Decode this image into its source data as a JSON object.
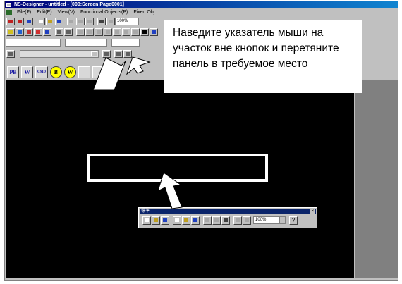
{
  "window": {
    "title": "NS-Designer - untitled - [000:Screen Page0001]"
  },
  "menubar": {
    "items": [
      "File(F)",
      "Edit(E)",
      "View(V)",
      "Functional Objects(P)",
      "Fixed Obj..."
    ]
  },
  "toolbar": {
    "zoom_value": "100%"
  },
  "object_bar": {
    "pb_label": "PB",
    "w_label": "W",
    "cmd_label": "CMD",
    "b_label": "B",
    "word_label": "W"
  },
  "floating_toolbar": {
    "title": "標準",
    "close_label": "×",
    "zoom_value": "100%",
    "help_label": "?"
  },
  "callout": {
    "text": "Наведите указатель мыши на участок вне кнопок и перетяните панель в требуемое место"
  },
  "colors": {
    "canvas": "#000000",
    "callout_bg": "#ffffff",
    "arrow": "#ffffff",
    "workspace_gray": "#808080",
    "title_bar": "#000078"
  }
}
